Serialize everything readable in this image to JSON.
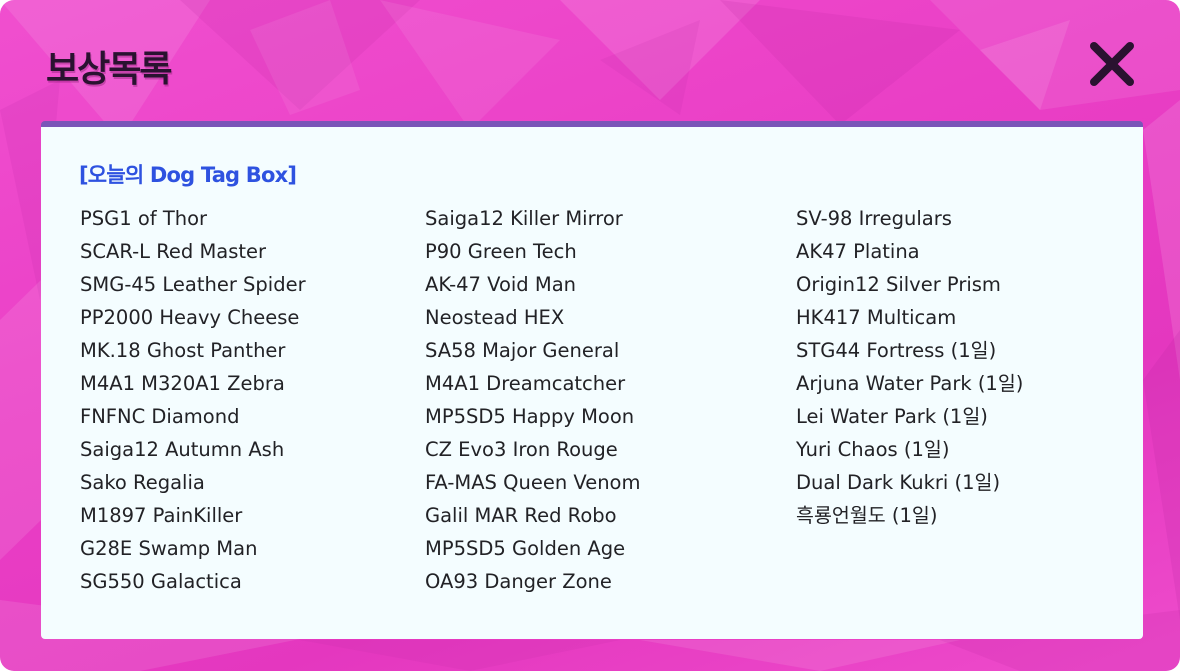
{
  "dialog": {
    "title": "보상목록",
    "close_icon": "close-icon"
  },
  "box": {
    "heading": "[오늘의 Dog Tag Box]",
    "columns": [
      [
        "PSG1 of Thor",
        "SCAR-L Red Master",
        "SMG-45 Leather Spider",
        "PP2000 Heavy Cheese",
        "MK.18 Ghost Panther",
        "M4A1 M320A1 Zebra",
        "FNFNC Diamond",
        "Saiga12 Autumn Ash",
        "Sako Regalia",
        "M1897 PainKiller",
        "G28E Swamp Man",
        "SG550 Galactica"
      ],
      [
        "Saiga12 Killer Mirror",
        "P90 Green Tech",
        "AK-47 Void Man",
        "Neostead HEX",
        "SA58 Major General",
        "M4A1 Dreamcatcher",
        "MP5SD5 Happy Moon",
        "CZ Evo3 Iron Rouge",
        "FA-MAS Queen Venom",
        "Galil MAR Red Robo",
        "MP5SD5 Golden Age",
        "OA93 Danger Zone"
      ],
      [
        "SV-98 Irregulars",
        "AK47 Platina",
        "Origin12 Silver Prism",
        "HK417 Multicam",
        "STG44 Fortress (1일)",
        "Arjuna Water Park (1일)",
        "Lei Water Park (1일)",
        "Yuri Chaos (1일)",
        "Dual Dark Kukri (1일)",
        "흑룡언월도 (1일)"
      ]
    ]
  },
  "colors": {
    "background": "#ea3fc6",
    "panel": "#f4fdff",
    "panel_border": "#7a55b8",
    "heading": "#2e52e0",
    "title": "#2a1230",
    "item_text": "#222226"
  }
}
